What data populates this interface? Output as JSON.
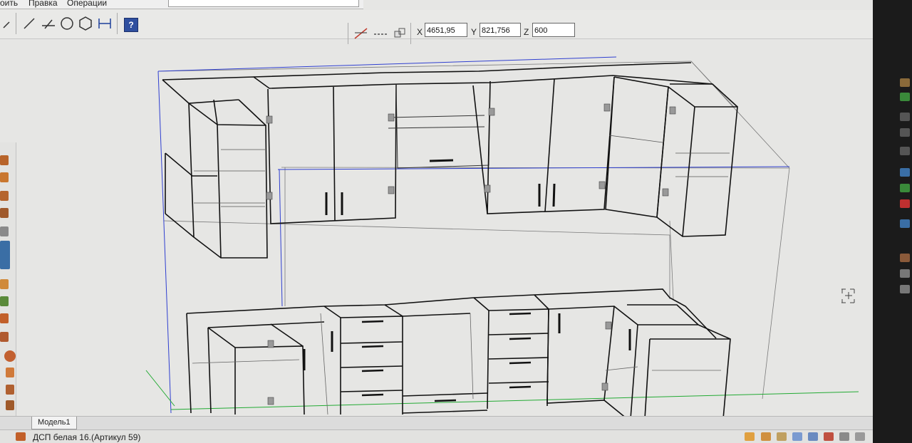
{
  "menu": {
    "items": [
      "оить",
      "Правка",
      "Операции"
    ]
  },
  "toolbar": {
    "tools": [
      "line-tool",
      "parallel-line-tool",
      "circle-tool",
      "hexagon-tool",
      "dimension-tool"
    ],
    "help_label": "?"
  },
  "coordinates": {
    "x_label": "X",
    "x_value": "4651,95",
    "y_label": "Y",
    "y_value": "821,756",
    "z_label": "Z",
    "z_value": "600"
  },
  "viewport": {
    "line_color": "#111111",
    "axis_blue": "#2f3fd0",
    "axis_green": "#22aa33"
  },
  "tabs": [
    "Модель1"
  ],
  "status": {
    "material": "ДСП белая 16.(Артикул 59)"
  }
}
